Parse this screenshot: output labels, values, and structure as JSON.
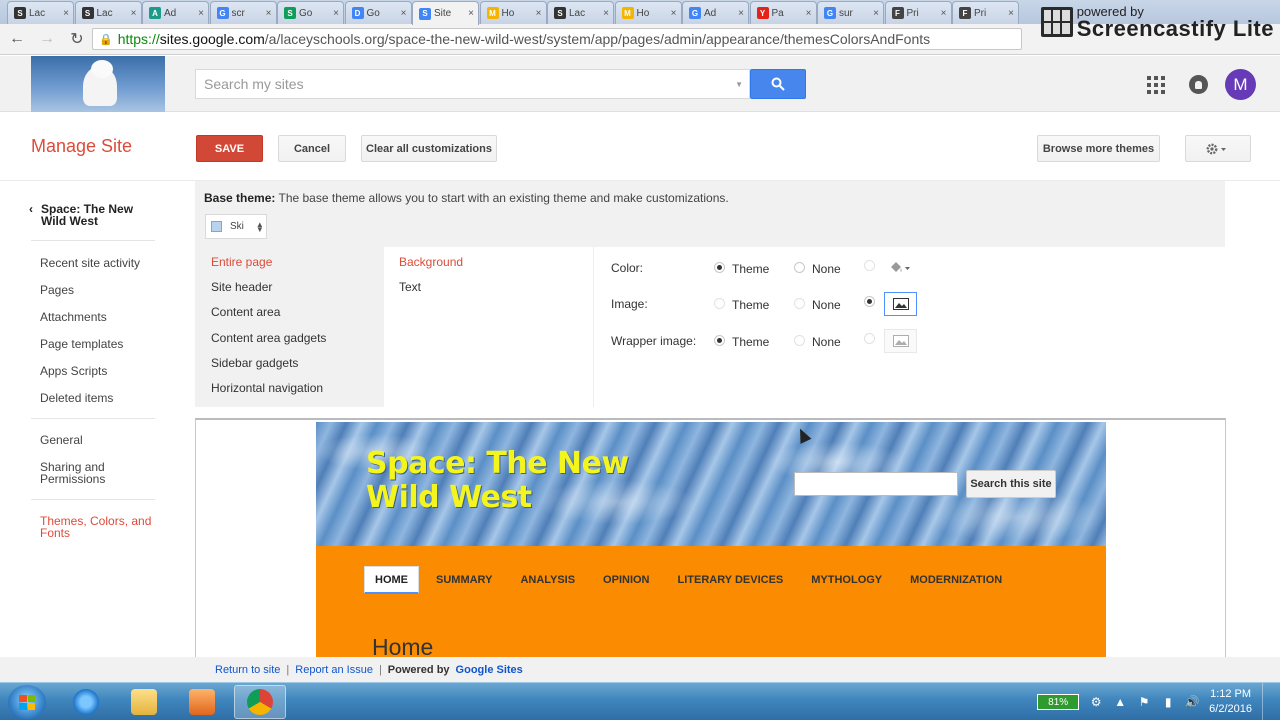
{
  "browser": {
    "tabs": [
      {
        "label": "Lac",
        "fav": "S",
        "color": "#333333"
      },
      {
        "label": "Lac",
        "fav": "S",
        "color": "#333333"
      },
      {
        "label": "Ad",
        "fav": "A",
        "color": "#1e9a8a"
      },
      {
        "label": "scr",
        "fav": "G",
        "color": "#4285f4"
      },
      {
        "label": "Go",
        "fav": "S",
        "color": "#0f9d58"
      },
      {
        "label": "Go",
        "fav": "D",
        "color": "#4285f4"
      },
      {
        "label": "Site",
        "fav": "S",
        "color": "#4285f4",
        "active": true
      },
      {
        "label": "Ho",
        "fav": "M",
        "color": "#f4b400"
      },
      {
        "label": "Lac",
        "fav": "S",
        "color": "#333333"
      },
      {
        "label": "Ho",
        "fav": "M",
        "color": "#f4b400"
      },
      {
        "label": "Ad",
        "fav": "G",
        "color": "#4285f4"
      },
      {
        "label": "Pa",
        "fav": "Y",
        "color": "#e62117"
      },
      {
        "label": "sur",
        "fav": "G",
        "color": "#4285f4"
      },
      {
        "label": "Pri",
        "fav": "F",
        "color": "#444444"
      },
      {
        "label": "Pri",
        "fav": "F",
        "color": "#444444"
      }
    ],
    "url_https": "https://",
    "url_host": "sites.google.com",
    "url_path": "/a/laceyschools.org/space-the-new-wild-west/system/app/pages/admin/appearance/themesColorsAndFonts",
    "screencastify_small": "powered by",
    "screencastify_big": "Screencastify Lite"
  },
  "app": {
    "search_placeholder": "Search my sites",
    "avatar_letter": "M"
  },
  "manage": {
    "title": "Manage Site",
    "save": "SAVE",
    "cancel": "Cancel",
    "clear": "Clear all customizations",
    "browse": "Browse more themes"
  },
  "leftnav": {
    "site_name": "Space: The New Wild West",
    "items": [
      "Recent site activity",
      "Pages",
      "Attachments",
      "Page templates",
      "Apps Scripts",
      "Deleted items"
    ],
    "general": "General",
    "sharing": "Sharing and Permissions",
    "themes": "Themes, Colors, and Fonts"
  },
  "editor": {
    "base_label": "Base theme:",
    "base_desc": "The base theme allows you to start with an existing theme and make customizations.",
    "theme_value": "Ski",
    "sections": [
      "Entire page",
      "Site header",
      "Content area",
      "Content area gadgets",
      "Sidebar gadgets",
      "Horizontal navigation"
    ],
    "props": [
      "Background",
      "Text"
    ],
    "options": [
      {
        "label": "Color:",
        "selected": "theme"
      },
      {
        "label": "Image:",
        "selected": "custom"
      },
      {
        "label": "Wrapper image:",
        "selected": "theme"
      }
    ],
    "theme_txt": "Theme",
    "none_txt": "None"
  },
  "preview": {
    "site_title": "Space: The New Wild West",
    "search_btn": "Search this site",
    "nav": [
      "HOME",
      "SUMMARY",
      "ANALYSIS",
      "OPINION",
      "LITERARY DEVICES",
      "MYTHOLOGY",
      "MODERNIZATION"
    ],
    "heading": "Home"
  },
  "footer": {
    "return": "Return to site",
    "report": "Report an Issue",
    "powered": "Powered by",
    "google_sites": "Google Sites"
  },
  "taskbar": {
    "battery": "81%",
    "time": "1:12 PM",
    "date": "6/2/2016"
  }
}
